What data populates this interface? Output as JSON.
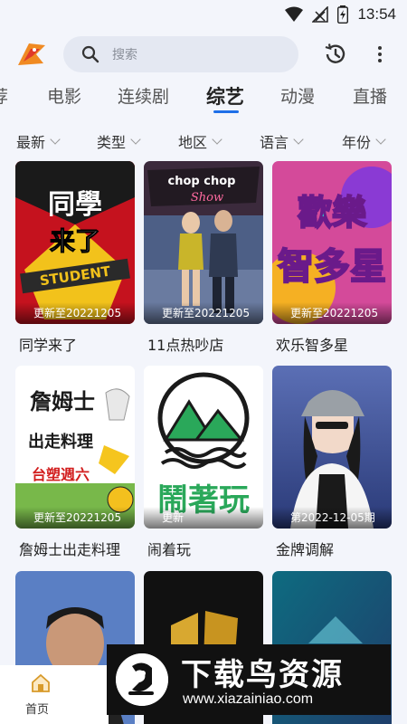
{
  "status_bar": {
    "time": "13:54"
  },
  "search": {
    "placeholder": "搜索"
  },
  "tabs": [
    {
      "label": "荐"
    },
    {
      "label": "电影"
    },
    {
      "label": "连续剧"
    },
    {
      "label": "综艺",
      "active": true
    },
    {
      "label": "动漫"
    },
    {
      "label": "直播"
    }
  ],
  "filters": [
    {
      "label": "最新"
    },
    {
      "label": "类型"
    },
    {
      "label": "地区"
    },
    {
      "label": "语言"
    },
    {
      "label": "年份"
    }
  ],
  "cards": [
    {
      "title": "同学来了",
      "badge": "更新至20221205",
      "poster_text": "同學来了 STUDENT",
      "icon": "classmate-poster"
    },
    {
      "title": "11点热吵店",
      "badge": "更新至20221205",
      "poster_text": "chop chop Show",
      "icon": "talkshow-poster"
    },
    {
      "title": "欢乐智多星",
      "badge": "更新至20221205",
      "poster_text": "歡樂智多星",
      "icon": "quiz-poster"
    },
    {
      "title": "詹姆士出走料理",
      "badge": "更新至20221205",
      "poster_text": "詹姆士出走料理 台塑週六",
      "icon": "cooking-poster"
    },
    {
      "title": "闹着玩",
      "badge": "更新",
      "poster_text": "鬧著玩",
      "icon": "mountain-poster"
    },
    {
      "title": "金牌调解",
      "badge": "第2022-12-05期",
      "poster_text": "",
      "icon": "portrait-poster"
    },
    {
      "title": "",
      "badge": "",
      "poster_text": "",
      "icon": "host-poster"
    },
    {
      "title": "",
      "badge": "",
      "poster_text": "",
      "icon": "gold-logo-poster"
    },
    {
      "title": "",
      "badge": "",
      "poster_text": "",
      "icon": "blue-poster"
    }
  ],
  "bottom_nav": {
    "home_label": "首页"
  },
  "watermark": {
    "title": "下载鸟资源",
    "url": "www.xiazainiao.com"
  },
  "colors": {
    "accent": "#1e6fe8",
    "background": "#f3f5fb"
  }
}
